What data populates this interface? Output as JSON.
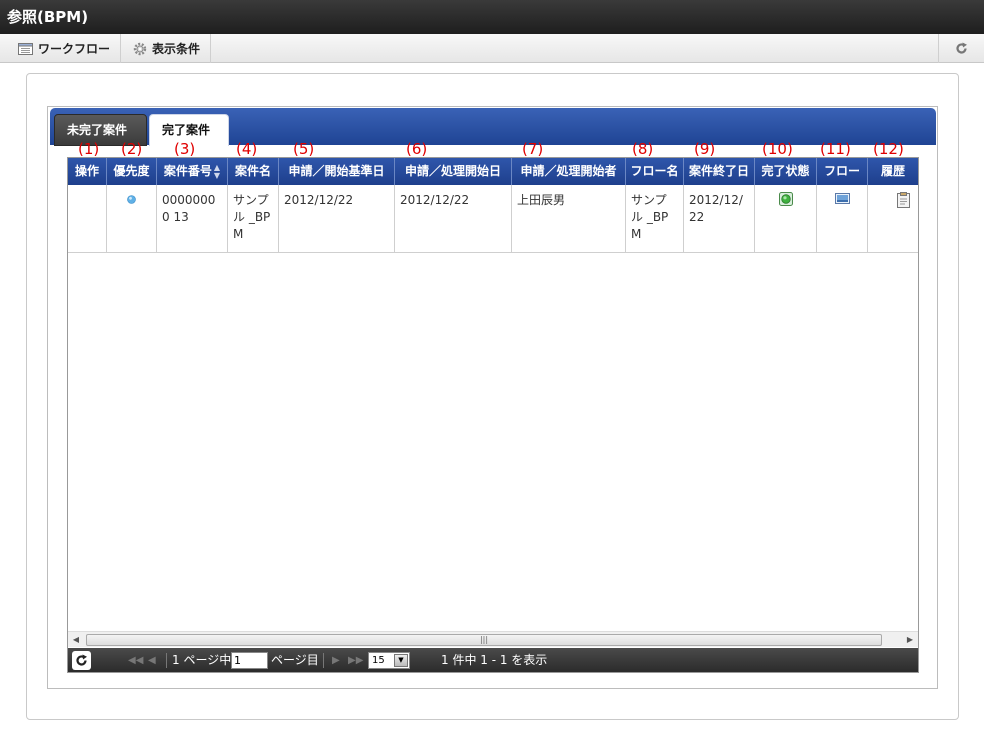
{
  "window": {
    "title": "参照(BPM)"
  },
  "toolbar": {
    "workflow_label": "ワークフロー",
    "display_conditions_label": "表示条件"
  },
  "tabs": [
    {
      "label": "未完了案件",
      "active": false
    },
    {
      "label": "完了案件",
      "active": true
    }
  ],
  "annotations": [
    "(1)",
    "(2)",
    "(3)",
    "(4)",
    "(5)",
    "(6)",
    "(7)",
    "(8)",
    "(9)",
    "(10)",
    "(11)",
    "(12)"
  ],
  "table": {
    "columns": [
      "操作",
      "優先度",
      "案件番号",
      "案件名",
      "申請／開始基準日",
      "申請／処理開始日",
      "申請／処理開始者",
      "フロー名",
      "案件終了日",
      "完了状態",
      "フロー",
      "履歴"
    ],
    "rows": [
      {
        "operation": "",
        "priority_icon": "blue-dot-icon",
        "case_number": "00000000 13",
        "case_name": "サンプル _BPM",
        "start_base_date": "2012/12/22",
        "process_start_date": "2012/12/22",
        "starter": "上田辰男",
        "flow_name": "サンプル _BPM",
        "end_date": "2012/12/22",
        "completion_icon": "green-complete-icon",
        "flow_icon": "flow-image-icon",
        "history_icon": "clipboard-icon"
      }
    ]
  },
  "pager": {
    "page_prefix": "1 ページ中",
    "page_value": "1",
    "page_suffix": "ページ目",
    "page_size": "15",
    "summary": "1 件中 1 - 1 を表示"
  },
  "colors": {
    "header_blue": "#2a4fa3",
    "annotation_red": "#e00000",
    "title_dark": "#2b2b2b"
  }
}
